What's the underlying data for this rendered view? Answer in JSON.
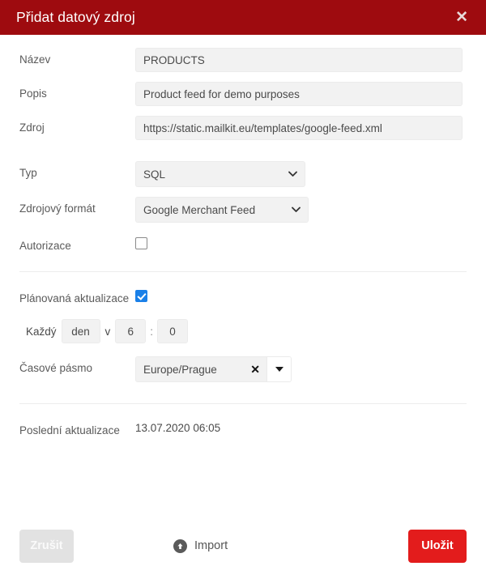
{
  "dialog": {
    "title": "Přidat datový zdroj",
    "close_icon": "close-icon"
  },
  "form": {
    "name": {
      "label": "Název",
      "value": "PRODUCTS"
    },
    "description": {
      "label": "Popis",
      "value": "Product feed for demo purposes"
    },
    "source": {
      "label": "Zdroj",
      "value": "https://static.mailkit.eu/templates/google-feed.xml"
    },
    "type": {
      "label": "Typ",
      "value": "SQL",
      "icon": "chevron-down-icon"
    },
    "format": {
      "label": "Zdrojový formát",
      "value": "Google Merchant Feed",
      "icon": "chevron-down-icon"
    },
    "authorization": {
      "label": "Autorizace",
      "checked": false
    },
    "scheduled_update": {
      "label": "Plánovaná aktualizace",
      "checked": true,
      "every_label": "Každý",
      "interval": "den",
      "at_label": "v",
      "hour": "6",
      "separator": ":",
      "minute": "0"
    },
    "timezone": {
      "label": "Časové pásmo",
      "value": "Europe/Prague",
      "clear_icon": "close-icon",
      "dropdown_icon": "caret-down-icon"
    },
    "last_update": {
      "label": "Poslední aktualizace",
      "value": "13.07.2020 06:05"
    }
  },
  "footer": {
    "cancel_label": "Zrušit",
    "import_label": "Import",
    "import_icon": "upload-circle-icon",
    "save_label": "Uložit"
  },
  "colors": {
    "header_red": "#9e0b0f",
    "save_red": "#e31c1c",
    "checkbox_blue": "#1a80e8",
    "field_gray": "#f2f2f2"
  }
}
